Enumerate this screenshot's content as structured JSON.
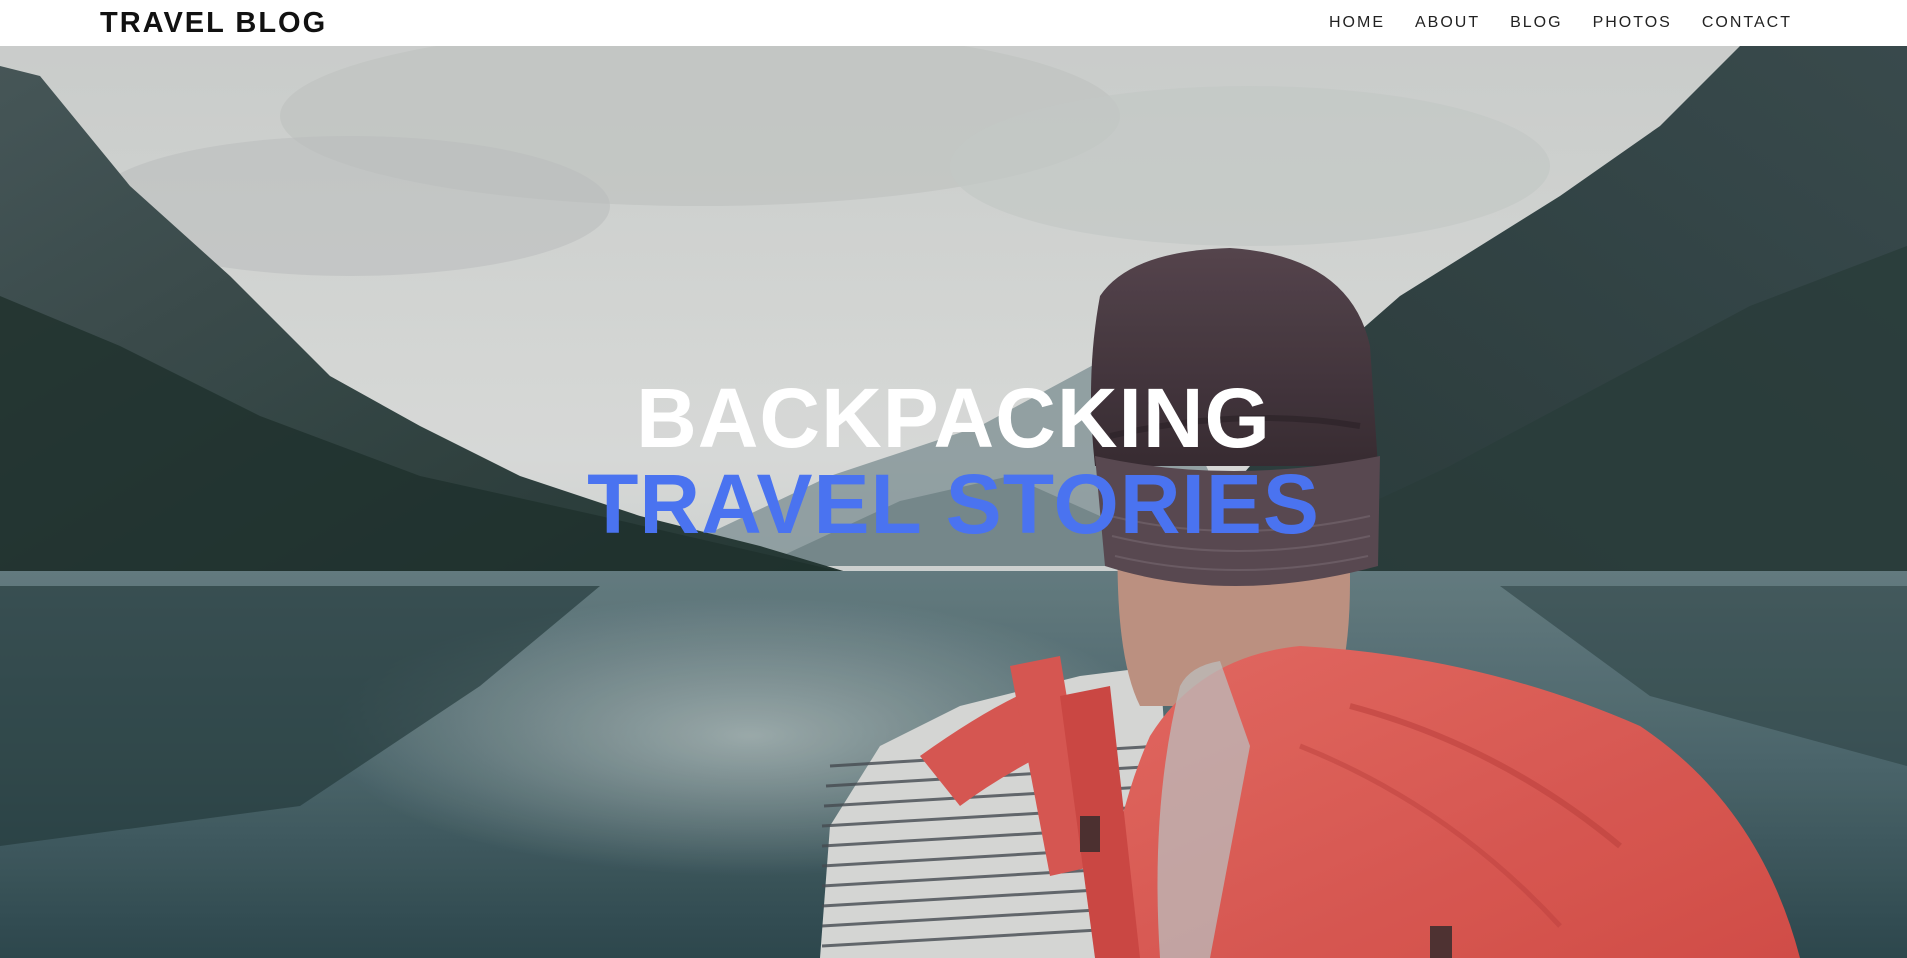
{
  "header": {
    "brand": "TRAVEL BLOG",
    "nav": [
      {
        "label": "HOME"
      },
      {
        "label": "ABOUT"
      },
      {
        "label": "BLOG"
      },
      {
        "label": "PHOTOS"
      },
      {
        "label": "CONTACT"
      }
    ]
  },
  "hero": {
    "title_line1": "BACKPACKING",
    "title_line2": "TRAVEL STORIES",
    "accent_color": "#4a73f0",
    "image": "backpacker-at-mountain-lake"
  }
}
